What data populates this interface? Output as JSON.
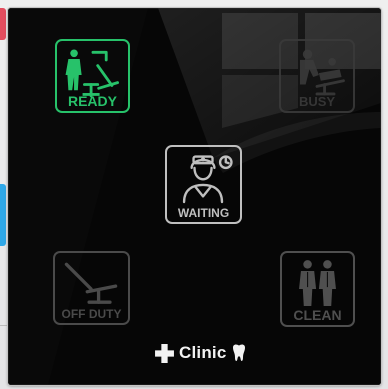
{
  "panel": {
    "title": "Clinic",
    "tiles": [
      {
        "id": "ready",
        "label": "READY",
        "icon": "dentist-chair-person-icon",
        "state": "active",
        "color": "#27c26a"
      },
      {
        "id": "busy",
        "label": "BUSY",
        "icon": "patient-treatment-icon",
        "state": "inactive",
        "color": "#3a3a3a"
      },
      {
        "id": "waiting",
        "label": "WAITING",
        "icon": "dentist-clock-icon",
        "state": "highlighted",
        "color": "#bfbfbf"
      },
      {
        "id": "offduty",
        "label": "OFF DUTY",
        "icon": "dental-chair-icon",
        "state": "inactive",
        "color": "#4a4a4a"
      },
      {
        "id": "clean",
        "label": "CLEAN",
        "icon": "cleaning-staff-icon",
        "state": "inactive",
        "color": "#4f4f4f"
      }
    ]
  }
}
